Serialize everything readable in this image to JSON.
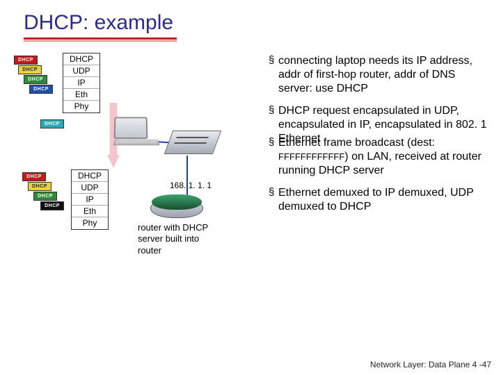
{
  "title": "DHCP: example",
  "tag_label": "DHCP",
  "stack": {
    "r0": "DHCP",
    "r1": "UDP",
    "r2": "IP",
    "r3": "Eth",
    "r4": "Phy"
  },
  "router_ip": "168. 1. 1. 1",
  "router_caption_l1": "router with DHCP",
  "router_caption_l2": "server built into",
  "router_caption_l3": "router",
  "bullets": {
    "b1": "connecting laptop needs its IP address, addr of first-hop router, addr of DNS server: use DHCP",
    "b2": "DHCP request encapsulated in UDP, encapsulated in IP, encapsulated in 802. 1 Ethernet",
    "b3_a": "Ethernet frame broadcast (dest: ",
    "b3_mac": "FFFFFFFFFFFF",
    "b3_b": ") on LAN, received at router running DHCP server",
    "b4": "Ethernet demuxed to IP demuxed, UDP demuxed to DHCP"
  },
  "footer": "Network Layer: Data Plane  4 -47",
  "colors": {
    "red": "#c21b1b",
    "yellow": "#e7d23a",
    "green": "#2f8a36",
    "blue": "#1d4eab",
    "cyan": "#2aa9b7"
  }
}
